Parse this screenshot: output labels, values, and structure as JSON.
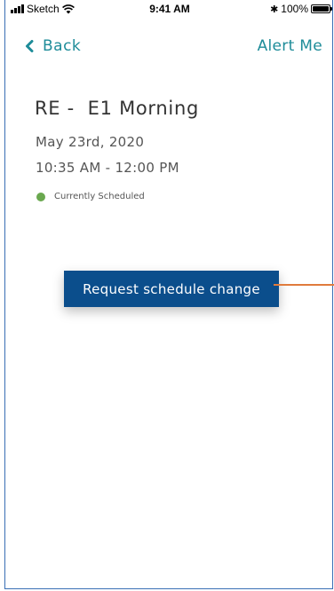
{
  "status_bar": {
    "carrier": "Sketch",
    "time": "9:41 AM",
    "battery": "100%",
    "battery_level": 1.0
  },
  "nav": {
    "back_label": "Back",
    "alert_label": "Alert Me"
  },
  "shift": {
    "title": "RE -  E1 Morning",
    "date": "May 23rd, 2020",
    "time_range": "10:35 AM - 12:00 PM",
    "status": "Currently Scheduled"
  },
  "actions": {
    "request_change_label": "Request schedule change"
  },
  "colors": {
    "accent": "#1e8c99",
    "primary_button": "#0b4e8c",
    "status_scheduled": "#6aa84f",
    "annotation": "#e07b3c",
    "frame_border": "#3a6fb5"
  },
  "icons": {
    "back": "chevron-left-icon",
    "signal": "signal-icon",
    "wifi": "wifi-icon",
    "bluetooth": "bluetooth-icon",
    "battery": "battery-icon"
  }
}
